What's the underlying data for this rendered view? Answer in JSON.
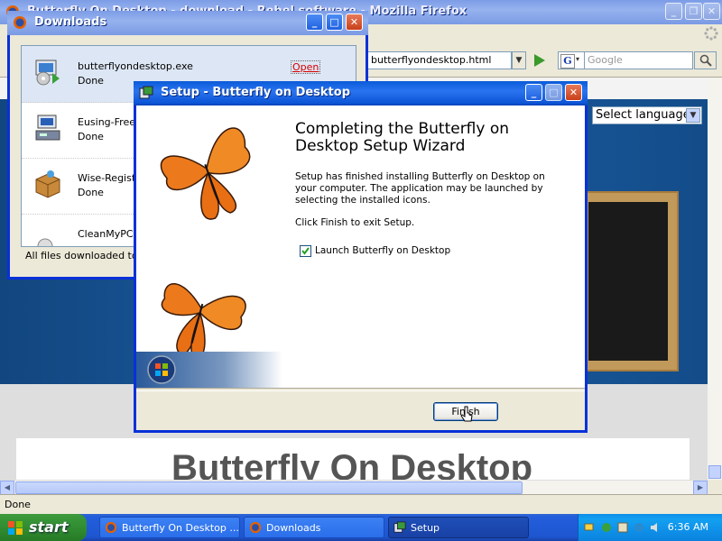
{
  "firefox": {
    "title": "Butterfly On Desktop - download - Rebel software - Mozilla Firefox",
    "url": "butterflyondesktop.html",
    "search_placeholder": "Google",
    "language_select": "Select language",
    "hero_title": "Butterfly On Desktop",
    "status": "Done"
  },
  "downloads": {
    "title": "Downloads",
    "items": [
      {
        "name": "butterflyondesktop.exe",
        "status": "Done",
        "action": "Open"
      },
      {
        "name": "Eusing-Free-",
        "status": "Done"
      },
      {
        "name": "Wise-Registr",
        "status": "Done"
      },
      {
        "name": "CleanMyPC-R",
        "status": ""
      }
    ],
    "footer": "All files downloaded to:"
  },
  "setup": {
    "title": "Setup - Butterfly on Desktop",
    "heading": "Completing the Butterfly on Desktop Setup Wizard",
    "body": "Setup has finished installing Butterfly on Desktop on your computer. The application may be launched by selecting the installed icons.",
    "finish_note": "Click Finish to exit Setup.",
    "launch_label": "Launch Butterfly on Desktop",
    "launch_checked": true,
    "finish_button": "Finish"
  },
  "taskbar": {
    "start": "start",
    "tasks": [
      {
        "label": "Butterfly On Desktop ...",
        "active": false
      },
      {
        "label": "Downloads",
        "active": false
      },
      {
        "label": "Setup",
        "active": true
      }
    ],
    "clock": "6:36 AM"
  },
  "colors": {
    "xp_blue": "#0a5ad8",
    "butterfly_orange": "#e8741c"
  }
}
